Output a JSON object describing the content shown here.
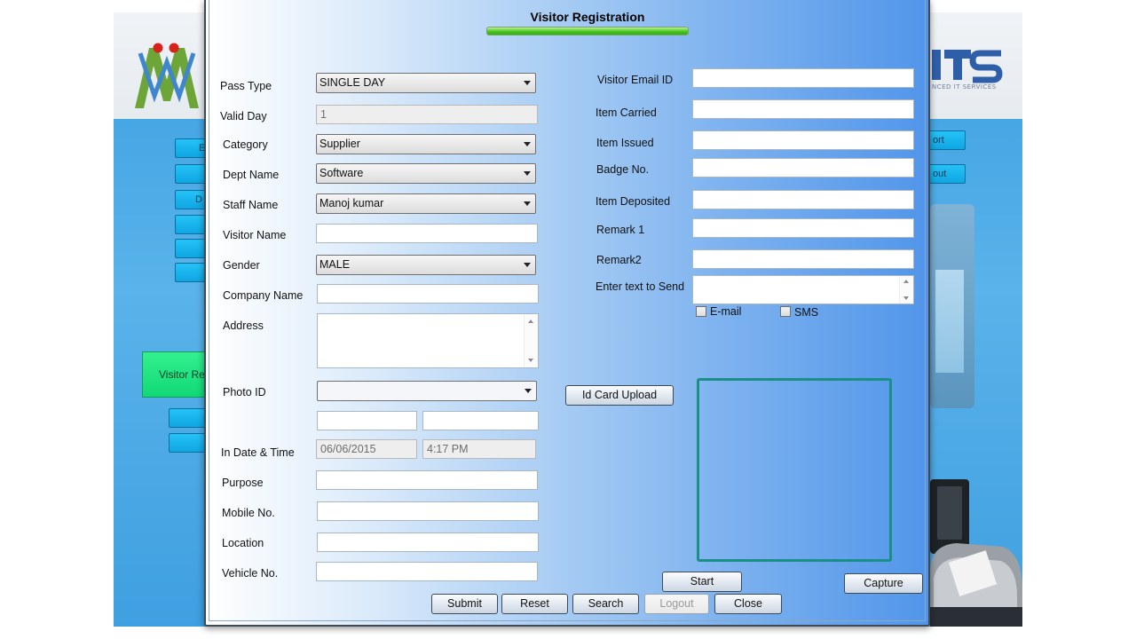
{
  "dialog": {
    "title": "Visitor Registration",
    "progress_fraction": 1.0
  },
  "background": {
    "brand_tag": "NCED IT SERVICES",
    "buttons": [
      "E",
      "",
      "D",
      "",
      "",
      ""
    ],
    "right_buttons": [
      "ort",
      "out"
    ],
    "visitor_button": "Visitor Re"
  },
  "left_form": {
    "pass_type": {
      "label": "Pass Type",
      "value": "SINGLE DAY"
    },
    "valid_day": {
      "label": "Valid Day",
      "value": "1"
    },
    "category": {
      "label": "Category",
      "value": "Supplier"
    },
    "dept_name": {
      "label": "Dept Name",
      "value": "Software"
    },
    "staff_name": {
      "label": "Staff Name",
      "value": "Manoj kumar"
    },
    "visitor_name": {
      "label": "Visitor Name",
      "value": ""
    },
    "gender": {
      "label": "Gender",
      "value": "MALE"
    },
    "company_name": {
      "label": "Company Name",
      "value": ""
    },
    "address": {
      "label": "Address",
      "value": ""
    },
    "photo_id": {
      "label": "Photo ID",
      "value": ""
    },
    "in_date_time": {
      "label": "In Date & Time",
      "date": "06/06/2015",
      "time": "4:17 PM"
    },
    "purpose": {
      "label": "Purpose",
      "value": ""
    },
    "mobile_no": {
      "label": "Mobile No.",
      "value": ""
    },
    "location": {
      "label": "Location",
      "value": ""
    },
    "vehicle_no": {
      "label": "Vehicle No.",
      "value": ""
    }
  },
  "right_form": {
    "visitor_email": {
      "label": "Visitor Email ID",
      "value": ""
    },
    "item_carried": {
      "label": "Item Carried",
      "value": ""
    },
    "item_issued": {
      "label": "Item Issued",
      "value": ""
    },
    "badge_no": {
      "label": "Badge No.",
      "value": ""
    },
    "item_deposited": {
      "label": "Item Deposited",
      "value": ""
    },
    "remark1": {
      "label": "Remark 1",
      "value": ""
    },
    "remark2": {
      "label": "Remark2",
      "value": ""
    },
    "enter_text": {
      "label": "Enter text to Send",
      "value": ""
    },
    "email_checkbox": {
      "label": "E-mail",
      "checked": false
    },
    "sms_checkbox": {
      "label": "SMS",
      "checked": false
    }
  },
  "buttons": {
    "id_card_upload": "Id Card Upload",
    "start": "Start",
    "capture": "Capture",
    "submit": "Submit",
    "reset": "Reset",
    "search": "Search",
    "logout": "Logout",
    "close": "Close"
  },
  "colors": {
    "accent_green": "#45c21c",
    "photo_frame": "#1a8f85",
    "dialog_gradient_end": "#5195ea",
    "bg_button_blue": "#0fa6e3",
    "bg_button_green": "#11d877"
  }
}
